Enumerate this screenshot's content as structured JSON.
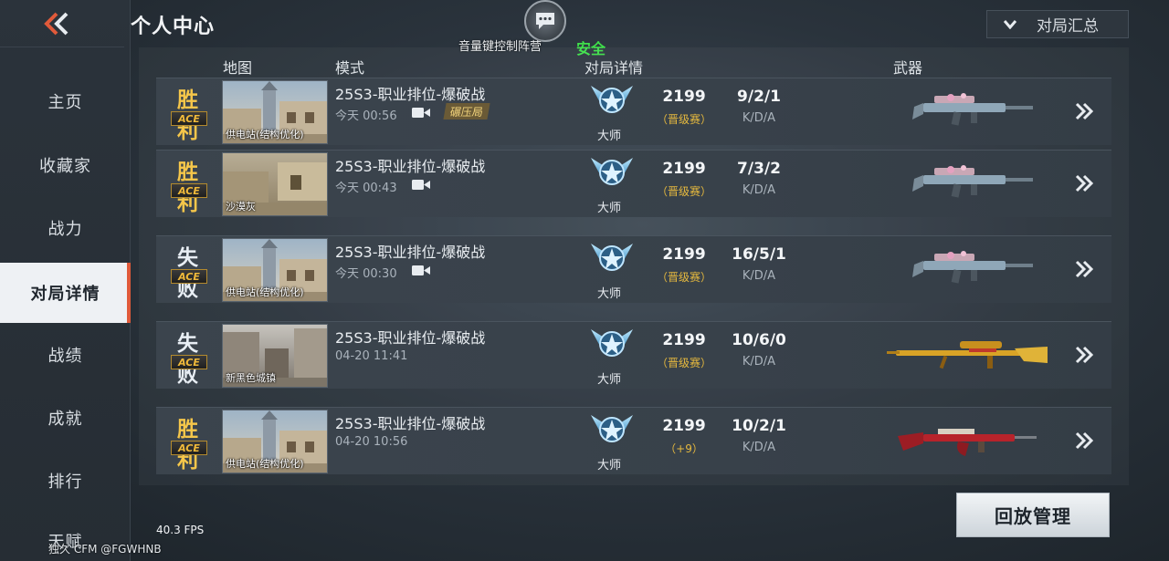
{
  "header": {
    "title": "个人中心",
    "voice_status": "音量键控制阵营",
    "safe_status": "安全",
    "summary_label": "对局汇总"
  },
  "sidebar": {
    "items": [
      {
        "label": "主页"
      },
      {
        "label": "收藏家"
      },
      {
        "label": "战力"
      },
      {
        "label": "对局详情",
        "active": true
      },
      {
        "label": "战绩"
      },
      {
        "label": "成就"
      },
      {
        "label": "排行"
      },
      {
        "label": "天赋"
      }
    ]
  },
  "table": {
    "columns": {
      "map": "地图",
      "mode": "模式",
      "details": "对局详情",
      "weapon": "武器"
    },
    "rows": [
      {
        "result": "胜利",
        "badge": "ACE",
        "map": "供电站(结构优化)",
        "mode": "25S3-职业排位-爆破战",
        "time": "今天 00:56",
        "tag": "碾压局",
        "rank": "大师",
        "score": "2199",
        "score_note": "（晋级赛）",
        "kda": "9/2/1",
        "kda_label": "K/D/A",
        "weapon": "rifle-pink"
      },
      {
        "result": "胜利",
        "badge": "ACE",
        "map": "沙漠灰",
        "mode": "25S3-职业排位-爆破战",
        "time": "今天 00:43",
        "tag": "",
        "rank": "大师",
        "score": "2199",
        "score_note": "（晋级赛）",
        "kda": "7/3/2",
        "kda_label": "K/D/A",
        "weapon": "rifle-pink"
      },
      {
        "result": "失败",
        "badge": "ACE",
        "map": "供电站(结构优化)",
        "mode": "25S3-职业排位-爆破战",
        "time": "今天 00:30",
        "tag": "",
        "rank": "大师",
        "score": "2199",
        "score_note": "（晋级赛）",
        "kda": "16/5/1",
        "kda_label": "K/D/A",
        "weapon": "rifle-pink"
      },
      {
        "result": "失败",
        "badge": "ACE",
        "map": "新黑色城镇",
        "mode": "25S3-职业排位-爆破战",
        "time": "04-20 11:41",
        "tag": "",
        "rank": "大师",
        "score": "2199",
        "score_note": "（晋级赛）",
        "kda": "10/6/0",
        "kda_label": "K/D/A",
        "weapon": "sniper-gold"
      },
      {
        "result": "胜利",
        "badge": "ACE",
        "map": "供电站(结构优化)",
        "mode": "25S3-职业排位-爆破战",
        "time": "04-20 10:56",
        "tag": "",
        "rank": "大师",
        "score": "2199",
        "score_note": "（+9）",
        "kda": "10/2/1",
        "kda_label": "K/D/A",
        "weapon": "ak-red"
      }
    ]
  },
  "footer": {
    "replay_label": "回放管理",
    "fps": "40.3 FPS",
    "watermark": "独久 CFM @FGWHNB"
  },
  "colors": {
    "win": "#f5c64a",
    "lose": "#e8eef4",
    "accent": "#e05a3a",
    "safe": "#3fe04a"
  }
}
